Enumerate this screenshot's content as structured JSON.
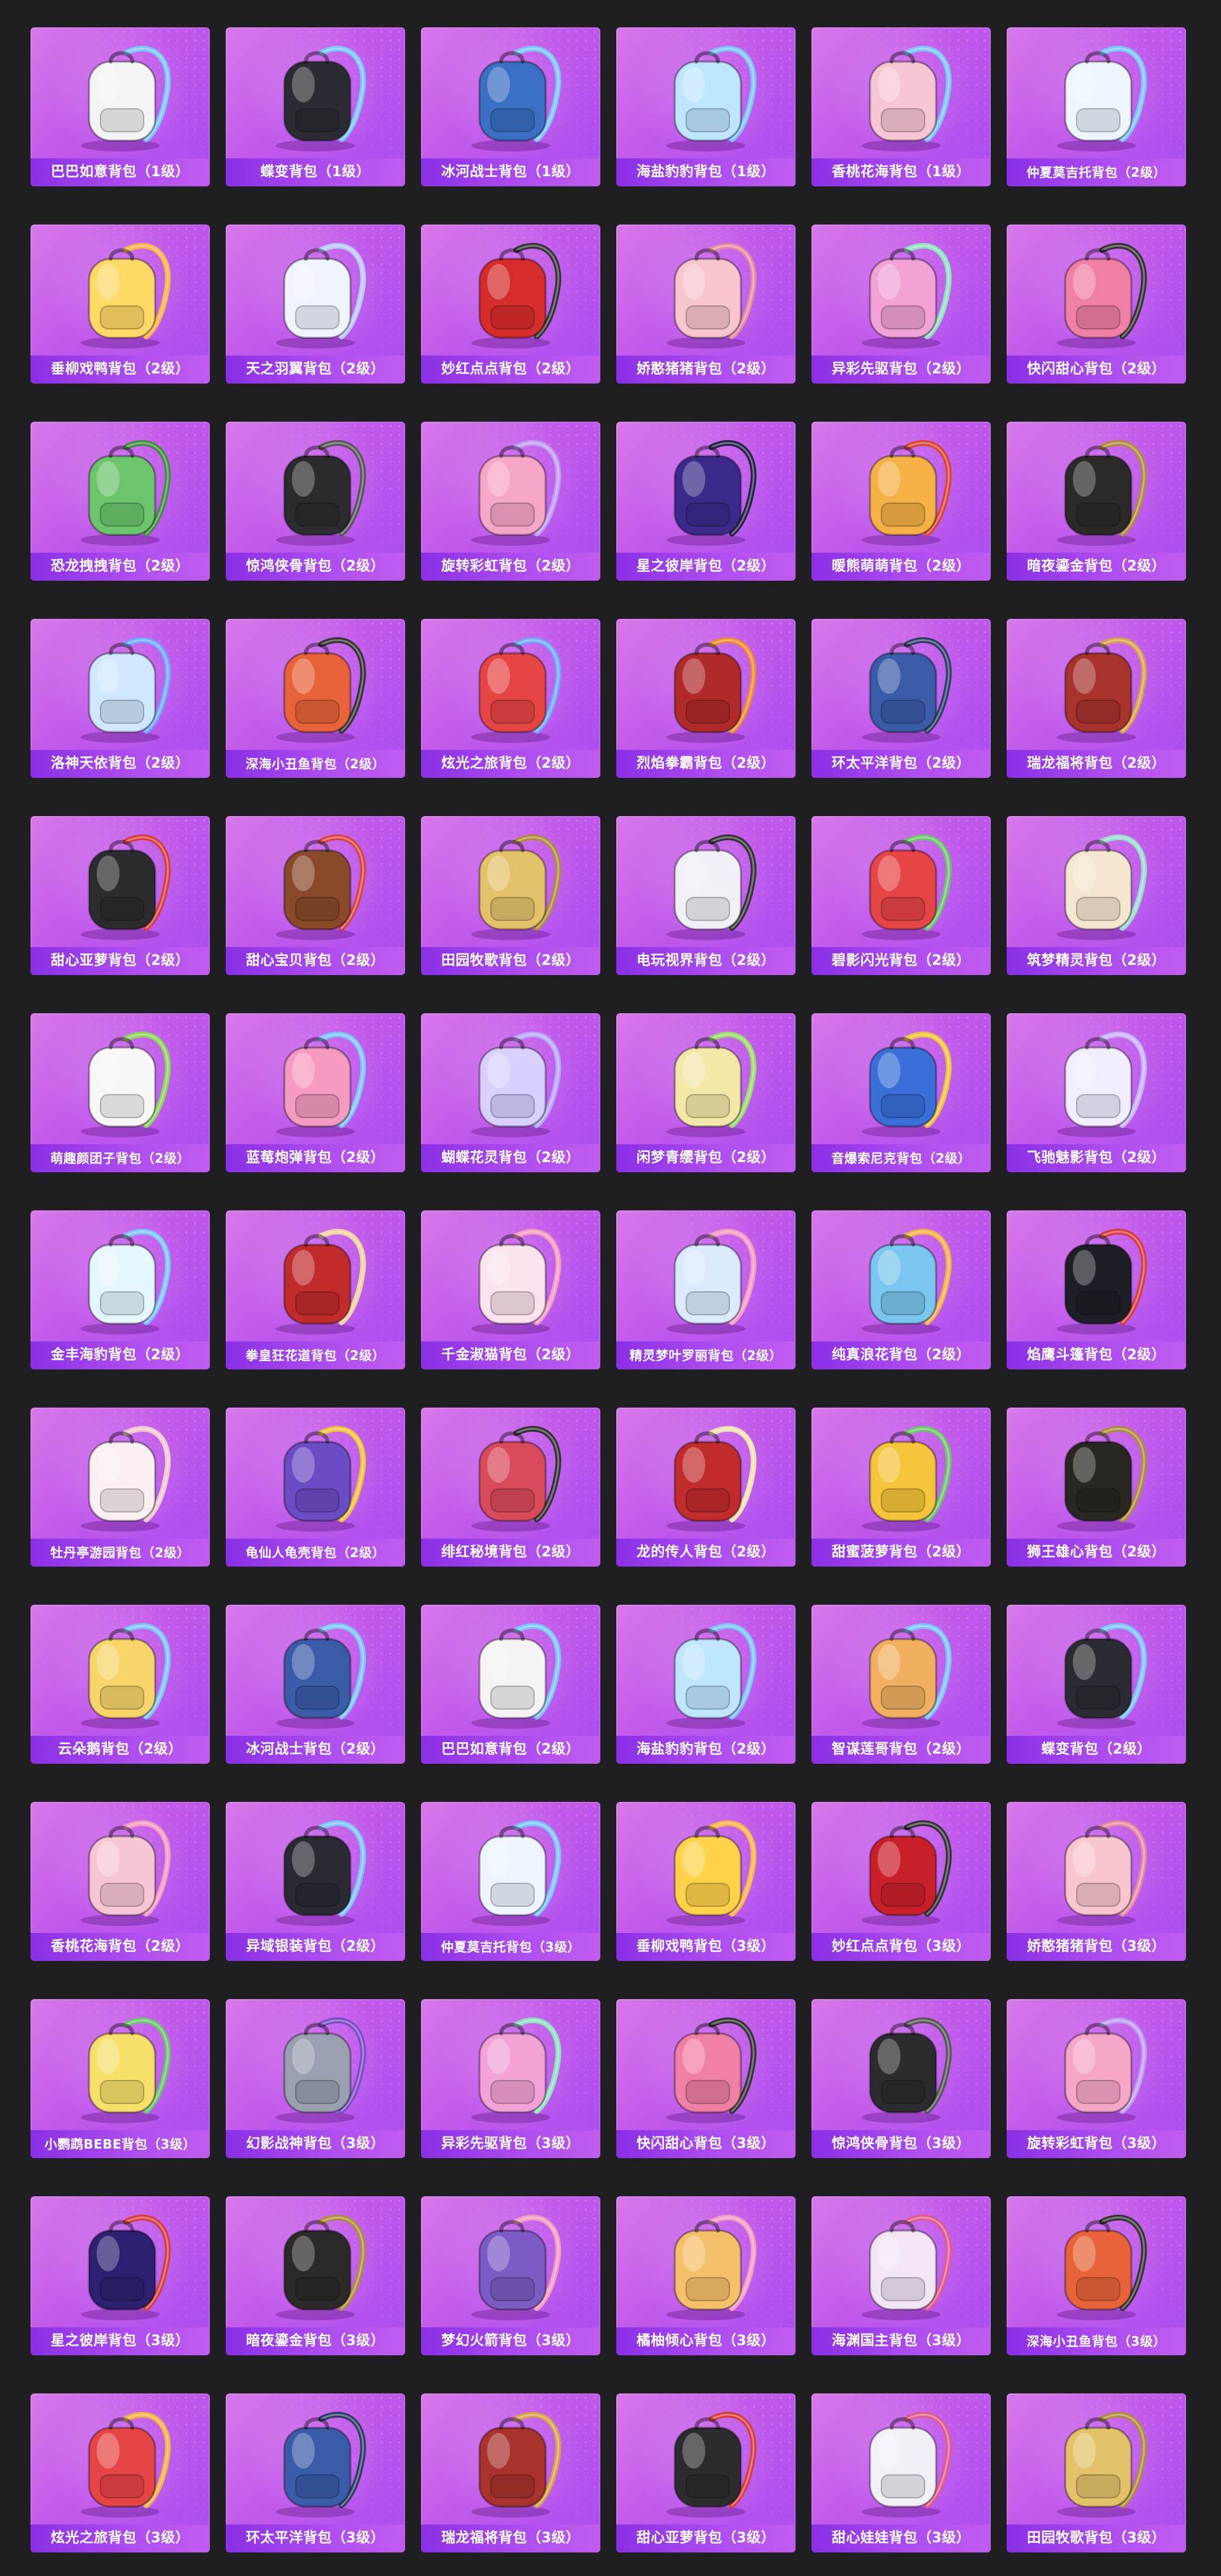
{
  "colors": {
    "page_background": "#1f1f21",
    "card_gradient_start": "#d779ea",
    "card_gradient_end": "#a94cf1",
    "label_bar": "#8a2fe6",
    "label_text": "#ffffff"
  },
  "items": [
    {
      "name": "巴巴如意背包（1级）",
      "icon": "bunny-backpack-icon",
      "color": "#f4f4f4",
      "strap": "#7cc3ff"
    },
    {
      "name": "蝶变背包（1级）",
      "icon": "black-backpack-icon",
      "color": "#2b2b33",
      "strap": "#7cc3ff"
    },
    {
      "name": "冰河战士背包（1级）",
      "icon": "blue-armor-backpack-icon",
      "color": "#3a6fc4",
      "strap": "#7cc3ff"
    },
    {
      "name": "海盐豹豹背包（1级）",
      "icon": "seal-backpack-icon",
      "color": "#bfe6ff",
      "strap": "#7cc3ff"
    },
    {
      "name": "香桃花海背包（1级）",
      "icon": "peach-blossom-backpack-icon",
      "color": "#f7c6d4",
      "strap": "#7cc3ff"
    },
    {
      "name": "仲夏莫吉托背包（2级）",
      "icon": "white-blue-backpack-icon",
      "color": "#eef5ff",
      "strap": "#7cc3ff"
    },
    {
      "name": "垂柳戏鸭背包（2级）",
      "icon": "duck-backpack-icon",
      "color": "#ffd966",
      "strap": "#ffb347"
    },
    {
      "name": "天之羽翼背包（2级）",
      "icon": "wing-backpack-icon",
      "color": "#f0f4ff",
      "strap": "#b9c6ff"
    },
    {
      "name": "妙红点点背包（2级）",
      "icon": "ladybug-backpack-icon",
      "color": "#d62c2c",
      "strap": "#333333"
    },
    {
      "name": "娇憨猪猪背包（2级）",
      "icon": "pig-backpack-icon",
      "color": "#f9c5cf",
      "strap": "#e68aa0"
    },
    {
      "name": "异彩先驱背包（2级）",
      "icon": "colorful-backpack-icon",
      "color": "#f2a2d6",
      "strap": "#8ee0c0"
    },
    {
      "name": "快闪甜心背包（2级）",
      "icon": "heart-backpack-icon",
      "color": "#f07fa6",
      "strap": "#333333"
    },
    {
      "name": "恐龙拽拽背包（2级）",
      "icon": "dinosaur-backpack-icon",
      "color": "#6cc46c",
      "strap": "#3f8f3f"
    },
    {
      "name": "惊鸿侠骨背包（2级）",
      "icon": "dark-backpack-icon",
      "color": "#2c2c30",
      "strap": "#555555"
    },
    {
      "name": "旋转彩虹背包（2级）",
      "icon": "rainbow-backpack-icon",
      "color": "#f6a6c7",
      "strap": "#c09cf0"
    },
    {
      "name": "星之彼岸背包（2级）",
      "icon": "space-backpack-icon",
      "color": "#3b2a8a",
      "strap": "#222244"
    },
    {
      "name": "暖熊萌萌背包（2级）",
      "icon": "bear-backpack-icon",
      "color": "#f5b046",
      "strap": "#d9432f"
    },
    {
      "name": "暗夜鎏金背包（2级）",
      "icon": "gold-dark-backpack-icon",
      "color": "#2c2a28",
      "strap": "#b08a3c"
    },
    {
      "name": "洛神天依背包（2级）",
      "icon": "ice-crystal-backpack-icon",
      "color": "#cfe8ff",
      "strap": "#6fa8ff"
    },
    {
      "name": "深海小丑鱼背包（2级）",
      "icon": "clownfish-backpack-icon",
      "color": "#e8633a",
      "strap": "#333333"
    },
    {
      "name": "炫光之旅背包（2级）",
      "icon": "gashapon-backpack-icon",
      "color": "#e64545",
      "strap": "#6fa8ff"
    },
    {
      "name": "烈焰拳霸背包（2级）",
      "icon": "flame-backpack-icon",
      "color": "#b02a2a",
      "strap": "#f08a2f"
    },
    {
      "name": "环太平洋背包（2级）",
      "icon": "mecha-backpack-icon",
      "color": "#3a5ca8",
      "strap": "#2c3c66"
    },
    {
      "name": "瑞龙福将背包（2级）",
      "icon": "dragon-armor-backpack-icon",
      "color": "#a8322c",
      "strap": "#d9a04a"
    },
    {
      "name": "甜心亚萝背包（2级）",
      "icon": "cat-backpack-icon",
      "color": "#2c2c30",
      "strap": "#d63c3c"
    },
    {
      "name": "甜心宝贝背包（2级）",
      "icon": "milkshake-backpack-icon",
      "color": "#8a4a2a",
      "strap": "#d9433f"
    },
    {
      "name": "田园牧歌背包（2级）",
      "icon": "basket-backpack-icon",
      "color": "#e3c26a",
      "strap": "#b08a3c"
    },
    {
      "name": "电玩视界背包（2级）",
      "icon": "arcade-backpack-icon",
      "color": "#f0f0f6",
      "strap": "#333333"
    },
    {
      "name": "碧影闪光背包（2级）",
      "icon": "gamepad-backpack-icon",
      "color": "#e64545",
      "strap": "#6cc46c"
    },
    {
      "name": "筑梦精灵背包（2级）",
      "icon": "shell-backpack-icon",
      "color": "#f5e6d0",
      "strap": "#9ad9cf"
    },
    {
      "name": "萌趣颜团子背包（2级）",
      "icon": "rabbit-plush-backpack-icon",
      "color": "#f7f7f7",
      "strap": "#8fd45a"
    },
    {
      "name": "蓝莓炮弹背包（2级）",
      "icon": "cake-backpack-icon",
      "color": "#f59ac0",
      "strap": "#7cc3ff"
    },
    {
      "name": "蝴蝶花灵背包（2级）",
      "icon": "butterfly-backpack-icon",
      "color": "#d8d0ff",
      "strap": "#b6a8ff"
    },
    {
      "name": "闲梦青缨背包（2级）",
      "icon": "lantern-backpack-icon",
      "color": "#f3e8a8",
      "strap": "#9ad96a"
    },
    {
      "name": "音爆索尼克背包（2级）",
      "icon": "sonic-backpack-icon",
      "color": "#3a6fd8",
      "strap": "#f0c23a"
    },
    {
      "name": "飞驰魅影背包（2级）",
      "icon": "ghost-backpack-icon",
      "color": "#f2ecff",
      "strap": "#c7b3ff"
    },
    {
      "name": "金丰海豹背包（2级）",
      "icon": "glass-seal-backpack-icon",
      "color": "#e6f6ff",
      "strap": "#7cc3ff"
    },
    {
      "name": "拳皇狂花道背包（2级）",
      "icon": "fighter-backpack-icon",
      "color": "#c22b2b",
      "strap": "#f0d0a0"
    },
    {
      "name": "千金淑猫背包（2级）",
      "icon": "pink-cat-backpack-icon",
      "color": "#fbe3ee",
      "strap": "#f59ac0"
    },
    {
      "name": "精灵梦叶罗丽背包（2级）",
      "icon": "fairy-heart-backpack-icon",
      "color": "#dceaff",
      "strap": "#f59ac0"
    },
    {
      "name": "纯真浪花背包（2级）",
      "icon": "drink-cup-backpack-icon",
      "color": "#7ac6f0",
      "strap": "#f5b046"
    },
    {
      "name": "焰鹰斗篷背包（2级）",
      "icon": "hawk-cloak-backpack-icon",
      "color": "#1e1e26",
      "strap": "#d63c3c"
    },
    {
      "name": "牡丹亭游园背包（2级）",
      "icon": "handbag-backpack-icon",
      "color": "#faf0f2",
      "strap": "#f0c6d0"
    },
    {
      "name": "龟仙人龟壳背包（2级）",
      "icon": "turtle-shell-backpack-icon",
      "color": "#6a4cc4",
      "strap": "#f0c23a"
    },
    {
      "name": "绯红秘境背包（2级）",
      "icon": "crimson-backpack-icon",
      "color": "#d94a5a",
      "strap": "#333333"
    },
    {
      "name": "龙的传人背包（2级）",
      "icon": "chinese-backpack-icon",
      "color": "#c22b2b",
      "strap": "#f0e0b0"
    },
    {
      "name": "甜蜜菠萝背包（2级）",
      "icon": "pineapple-backpack-icon",
      "color": "#f5c43a",
      "strap": "#6cc46c"
    },
    {
      "name": "狮王雄心背包（2级）",
      "icon": "lion-backpack-icon",
      "color": "#2a2622",
      "strap": "#b08a3c"
    },
    {
      "name": "云朵鹅背包（2级）",
      "icon": "goose-backpack-icon",
      "color": "#f7d56a",
      "strap": "#7cc3ff"
    },
    {
      "name": "冰河战士背包（2级）",
      "icon": "blue-armor-backpack-icon",
      "color": "#3a5ca8",
      "strap": "#7cc3ff"
    },
    {
      "name": "巴巴如意背包（2级）",
      "icon": "bunny-backpack-icon",
      "color": "#f4f4f4",
      "strap": "#7cc3ff"
    },
    {
      "name": "海盐豹豹背包（2级）",
      "icon": "seal-backpack-icon",
      "color": "#bfe6ff",
      "strap": "#7cc3ff"
    },
    {
      "name": "智谋莲哥背包（2级）",
      "icon": "hamster-backpack-icon",
      "color": "#f0b060",
      "strap": "#7cc3ff"
    },
    {
      "name": "蝶变背包（2级）",
      "icon": "black-backpack-icon",
      "color": "#2b2b33",
      "strap": "#7cc3ff"
    },
    {
      "name": "香桃花海背包（2级）",
      "icon": "peach-blossom-backpack-icon",
      "color": "#f7c6d4",
      "strap": "#f59ac0"
    },
    {
      "name": "异域银装背包（2级）",
      "icon": "tech-backpack-icon",
      "color": "#2a2a33",
      "strap": "#7cc3ff"
    },
    {
      "name": "仲夏莫吉托背包（3级）",
      "icon": "white-blue-backpack-icon",
      "color": "#eef5ff",
      "strap": "#7cc3ff"
    },
    {
      "name": "垂柳戏鸭背包（3级）",
      "icon": "duck-backpack-icon",
      "color": "#ffd24a",
      "strap": "#ffb347"
    },
    {
      "name": "妙红点点背包（3级）",
      "icon": "ladybug-backpack-icon",
      "color": "#c91f2a",
      "strap": "#333333"
    },
    {
      "name": "娇憨猪猪背包（3级）",
      "icon": "pig-backpack-icon",
      "color": "#f9c5cf",
      "strap": "#e68aa0"
    },
    {
      "name": "小鹦鹉BEBE背包（3级）",
      "icon": "chick-backpack-icon",
      "color": "#f7e06a",
      "strap": "#6cc46c"
    },
    {
      "name": "幻影战神背包（3级）",
      "icon": "silver-armor-backpack-icon",
      "color": "#9aa0b0",
      "strap": "#7a4cc4"
    },
    {
      "name": "异彩先驱背包（3级）",
      "icon": "colorful-backpack-icon",
      "color": "#f2a2d6",
      "strap": "#8ee0c0"
    },
    {
      "name": "快闪甜心背包（3级）",
      "icon": "heart-backpack-icon",
      "color": "#f07fa6",
      "strap": "#333333"
    },
    {
      "name": "惊鸿侠骨背包（3级）",
      "icon": "dark-backpack-icon",
      "color": "#2c2c30",
      "strap": "#555555"
    },
    {
      "name": "旋转彩虹背包（3级）",
      "icon": "rainbow-backpack-icon",
      "color": "#f6a6c7",
      "strap": "#c09cf0"
    },
    {
      "name": "星之彼岸背包（3级）",
      "icon": "space-backpack-icon",
      "color": "#2e2070",
      "strap": "#d63c3c"
    },
    {
      "name": "暗夜鎏金背包（3级）",
      "icon": "gold-dark-backpack-icon",
      "color": "#2c2a28",
      "strap": "#b08a3c"
    },
    {
      "name": "梦幻火箭背包（3级）",
      "icon": "rocket-backpack-icon",
      "color": "#7a5cc4",
      "strap": "#f59ac0"
    },
    {
      "name": "橘柚倾心背包（3级）",
      "icon": "orange-backpack-icon",
      "color": "#f5c06a",
      "strap": "#f59ac0"
    },
    {
      "name": "海渊国主背包（3级）",
      "icon": "sea-king-backpack-icon",
      "color": "#f2e6f5",
      "strap": "#e05a8a"
    },
    {
      "name": "深海小丑鱼背包（3级）",
      "icon": "clownfish-backpack-icon",
      "color": "#e8633a",
      "strap": "#333333"
    },
    {
      "name": "炫光之旅背包（3级）",
      "icon": "gashapon-backpack-icon",
      "color": "#e64545",
      "strap": "#f5b046"
    },
    {
      "name": "环太平洋背包（3级）",
      "icon": "mecha-backpack-icon",
      "color": "#3a5ca8",
      "strap": "#2c3c66"
    },
    {
      "name": "瑞龙福将背包（3级）",
      "icon": "dragon-armor-backpack-icon",
      "color": "#a8322c",
      "strap": "#d9a04a"
    },
    {
      "name": "甜心亚萝背包（3级）",
      "icon": "cat-backpack-icon",
      "color": "#2c2c30",
      "strap": "#d63c3c"
    },
    {
      "name": "甜心娃娃背包（3级）",
      "icon": "doll-backpack-icon",
      "color": "#f2f0f6",
      "strap": "#e05a8a"
    },
    {
      "name": "田园牧歌背包（3级）",
      "icon": "basket-backpack-icon",
      "color": "#e3c26a",
      "strap": "#b08a3c"
    }
  ]
}
